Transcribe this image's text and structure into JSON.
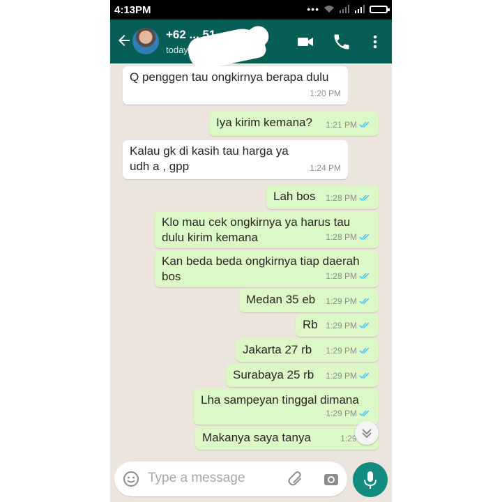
{
  "status_bar": {
    "time": "4:13PM"
  },
  "header": {
    "contact_name": "+62 ... 51...",
    "last_seen": "today at 1:39 PM"
  },
  "messages": [
    {
      "dir": "in",
      "text": "Q penggen tau ongkirnya berapa dulu",
      "time": "1:20 PM"
    },
    {
      "dir": "out",
      "text": "Iya kirim kemana?",
      "time": "1:21 PM"
    },
    {
      "dir": "in",
      "text": "Kalau gk di kasih tau harga ya udh a , gpp",
      "time": "1:24 PM"
    },
    {
      "dir": "out",
      "text": "Lah bos",
      "time": "1:28 PM"
    },
    {
      "dir": "out",
      "text": "Klo mau cek ongkirnya ya harus tau dulu kirim kemana",
      "time": "1:28 PM"
    },
    {
      "dir": "out",
      "text": "Kan beda beda ongkirnya tiap daerah bos",
      "time": "1:28 PM"
    },
    {
      "dir": "out",
      "text": "Medan 35 eb",
      "time": "1:29 PM"
    },
    {
      "dir": "out",
      "text": "Rb",
      "time": "1:29 PM"
    },
    {
      "dir": "out",
      "text": "Jakarta 27 rb",
      "time": "1:29 PM"
    },
    {
      "dir": "out",
      "text": "Surabaya 25 rb",
      "time": "1:29 PM"
    },
    {
      "dir": "out",
      "text": "Lha sampeyan tinggal dimana",
      "time": "1:29 PM"
    },
    {
      "dir": "out",
      "text": "Makanya saya tanya",
      "time": "1:29 PM"
    }
  ],
  "input": {
    "placeholder": "Type a message"
  },
  "colors": {
    "header": "#075e54",
    "outgoing_bubble": "#dcf8c6",
    "incoming_bubble": "#ffffff",
    "read_tick": "#4fc3f7",
    "mic_button": "#128c7e"
  }
}
